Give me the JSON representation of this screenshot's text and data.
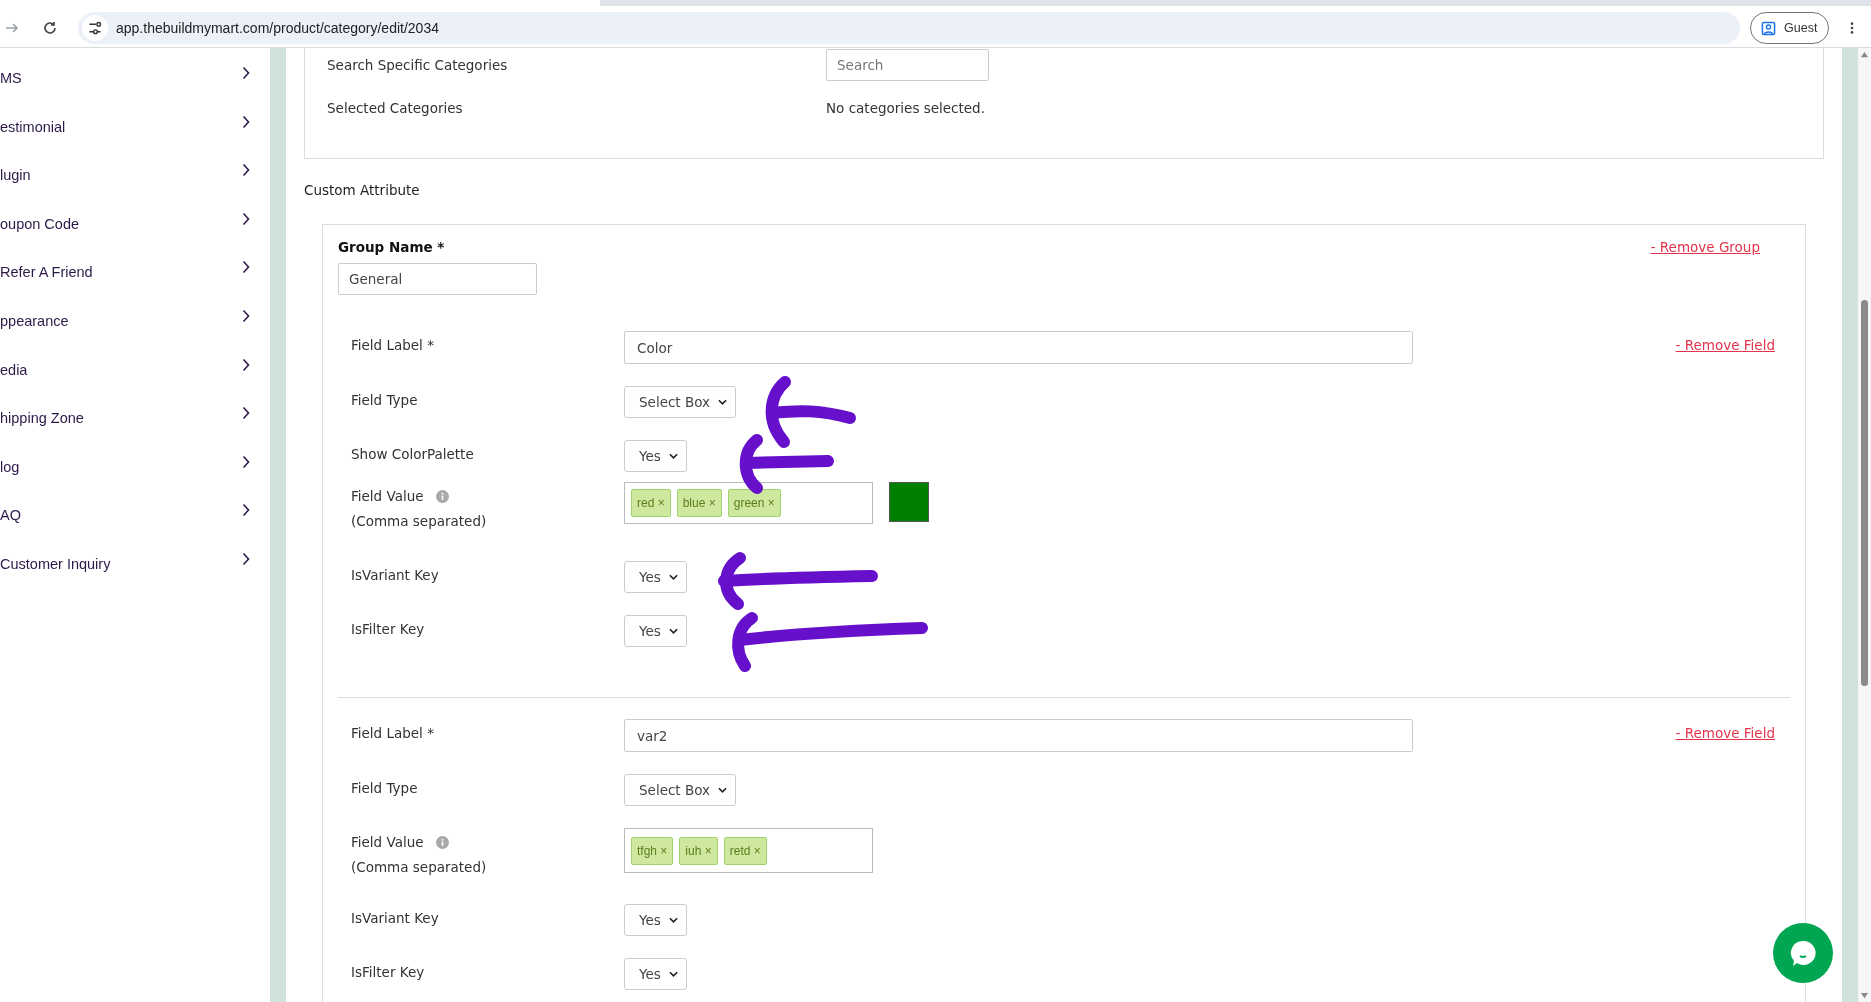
{
  "browser": {
    "url": "app.thebuildmymart.com/product/category/edit/2034",
    "profile": "Guest"
  },
  "sidebar": {
    "items": [
      {
        "label": "MS"
      },
      {
        "label": "estimonial"
      },
      {
        "label": "lugin"
      },
      {
        "label": "oupon Code"
      },
      {
        "label": "Refer A Friend"
      },
      {
        "label": "ppearance"
      },
      {
        "label": "edia"
      },
      {
        "label": "hipping Zone"
      },
      {
        "label": "log"
      },
      {
        "label": "AQ"
      },
      {
        "label": "Customer Inquiry"
      }
    ]
  },
  "categories": {
    "search_label": "Search Specific Categories",
    "search_placeholder": "Search",
    "selected_label": "Selected Categories",
    "selected_value": "No categories selected."
  },
  "custom_attribute": {
    "title": "Custom Attribute",
    "group": {
      "name_label": "Group Name *",
      "name_value": "General",
      "remove": "- Remove Group",
      "fields": [
        {
          "remove": "- Remove Field",
          "rows": [
            {
              "kind": "text",
              "label": "Field Label *",
              "value": "Color"
            },
            {
              "kind": "select",
              "label": "Field Type",
              "value": "Select Box"
            },
            {
              "kind": "select",
              "label": "Show ColorPalette",
              "value": "Yes"
            },
            {
              "kind": "tags",
              "label": "Field Value",
              "note": "(Comma separated)",
              "tags": [
                {
                  "text": "red",
                  "remove": "×"
                },
                {
                  "text": "blue",
                  "remove": "×"
                },
                {
                  "text": "green",
                  "remove": "×"
                }
              ],
              "color": "#008000"
            },
            {
              "kind": "select",
              "label": "IsVariant Key",
              "value": "Yes"
            },
            {
              "kind": "select",
              "label": "IsFilter Key",
              "value": "Yes"
            }
          ]
        },
        {
          "remove": "- Remove Field",
          "rows": [
            {
              "kind": "text",
              "label": "Field Label *",
              "value": "var2"
            },
            {
              "kind": "select",
              "label": "Field Type",
              "value": "Select Box"
            },
            {
              "kind": "tags",
              "label": "Field Value",
              "note": "(Comma separated)",
              "tags": [
                {
                  "text": "tfgh",
                  "remove": "×"
                },
                {
                  "text": "iuh",
                  "remove": "×"
                },
                {
                  "text": "retd",
                  "remove": "×"
                }
              ]
            },
            {
              "kind": "select",
              "label": "IsVariant Key",
              "value": "Yes"
            },
            {
              "kind": "select",
              "label": "IsFilter Key",
              "value": "Yes"
            }
          ]
        }
      ]
    }
  }
}
